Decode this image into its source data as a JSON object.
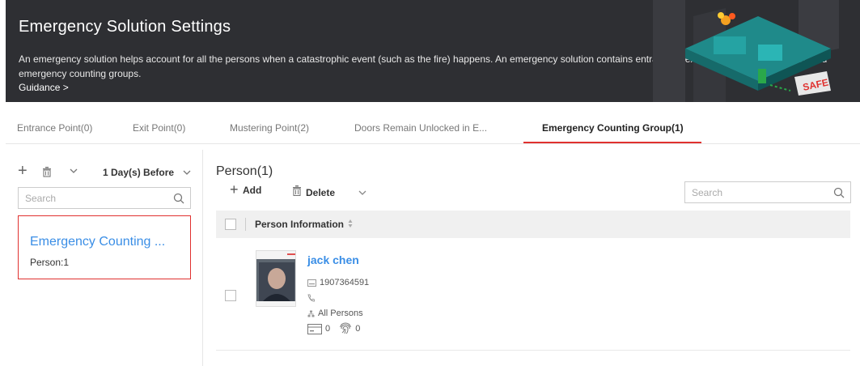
{
  "banner": {
    "title": "Emergency Solution Settings",
    "description": "An emergency solution helps account for all the persons when a catastrophic event (such as the fire) happens. An emergency solution contains entrance & exit points, mustering points, and emergency counting groups.",
    "guidance_link": "Guidance >",
    "art_sign": "SAFE"
  },
  "tabs": [
    {
      "label": "Entrance Point(0)",
      "active": false
    },
    {
      "label": "Exit Point(0)",
      "active": false
    },
    {
      "label": "Mustering Point(2)",
      "active": false
    },
    {
      "label": "Doors Remain Unlocked in E...",
      "active": false
    },
    {
      "label": "Emergency Counting Group(1)",
      "active": true
    }
  ],
  "left_panel": {
    "date_filter": "1 Day(s) Before",
    "search_placeholder": "Search",
    "groups": [
      {
        "name": "Emergency Counting ...",
        "count": "Person:1"
      }
    ]
  },
  "right_panel": {
    "title": "Person(1)",
    "add_label": "Add",
    "delete_label": "Delete",
    "search_placeholder": "Search",
    "column_header": "Person Information",
    "persons": [
      {
        "name": "jack chen",
        "id": "1907364591",
        "phone": "",
        "org": "All Persons",
        "cards": "0",
        "fingerprints": "0"
      }
    ]
  },
  "colors": {
    "accent_red": "#e0312f",
    "link_blue": "#3a8ee6",
    "banner_bg": "#2e2f33"
  }
}
